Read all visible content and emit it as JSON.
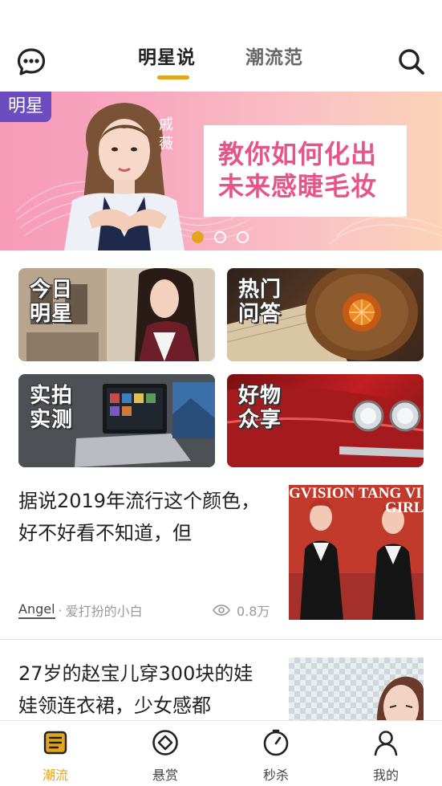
{
  "header": {
    "tabs": [
      {
        "label": "明星说",
        "active": true
      },
      {
        "label": "潮流范",
        "active": false
      }
    ],
    "icons": {
      "left": "chat-bubble-icon",
      "right": "search-icon"
    },
    "accent_color": "#e2a51b"
  },
  "banner": {
    "badge": "明星",
    "star_name": "戚薇",
    "headline": [
      "教你如何化出",
      "未来感睫毛妆"
    ],
    "slide_count": 3,
    "active_slide": 1
  },
  "categories": [
    {
      "label_line1": "今日",
      "label_line2": "明星"
    },
    {
      "label_line1": "热门",
      "label_line2": "问答"
    },
    {
      "label_line1": "实拍",
      "label_line2": "实测"
    },
    {
      "label_line1": "好物",
      "label_line2": "众享"
    }
  ],
  "articles": [
    {
      "title": "据说2019年流行这个颜色，好不好看不知道，但",
      "author": "Angel",
      "author_tag": "爱打扮的小白",
      "views": "0.8万",
      "thumb_text": "GVISION TANG VI",
      "thumb_text2": "GIRL"
    },
    {
      "title": "27岁的赵宝儿穿300块的娃娃领连衣裙，少女感都"
    }
  ],
  "bottom_nav": [
    {
      "label": "潮流",
      "icon": "list-doc-icon",
      "active": true
    },
    {
      "label": "悬赏",
      "icon": "diamond-circle-icon",
      "active": false
    },
    {
      "label": "秒杀",
      "icon": "stopwatch-icon",
      "active": false
    },
    {
      "label": "我的",
      "icon": "user-icon",
      "active": false
    }
  ]
}
